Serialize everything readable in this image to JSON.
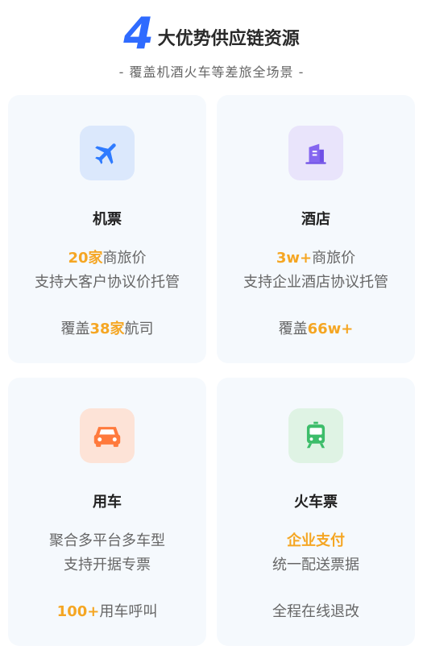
{
  "header": {
    "number": "4",
    "title": "大优势供应链资源",
    "subtitle": "- 覆盖机酒火车等差旅全场景 -"
  },
  "colors": {
    "accent_blue": "#2f6bff",
    "highlight_orange": "#f5a623",
    "card_bg": "#f5f9fd"
  },
  "cards": [
    {
      "icon": "airplane-icon",
      "name": "机票",
      "line1_hl": "20家",
      "line1_rest": "商旅价",
      "line2": "支持大客户协议价托管",
      "line3_pre": "覆盖",
      "line3_hl": "38家",
      "line3_post": "航司"
    },
    {
      "icon": "hotel-building-icon",
      "name": "酒店",
      "line1_hl": "3w+",
      "line1_rest": "商旅价",
      "line2": "支持企业酒店协议托管",
      "line3_pre": "覆盖",
      "line3_hl": "66w+",
      "line3_post": ""
    },
    {
      "icon": "car-icon",
      "name": "用车",
      "line1": "聚合多平台多车型",
      "line2": "支持开据专票",
      "line3_hl": "100+",
      "line3_post": "用车呼叫"
    },
    {
      "icon": "train-icon",
      "name": "火车票",
      "line1_hl": "企业支付",
      "line2": "统一配送票据",
      "line3": "全程在线退改"
    }
  ]
}
